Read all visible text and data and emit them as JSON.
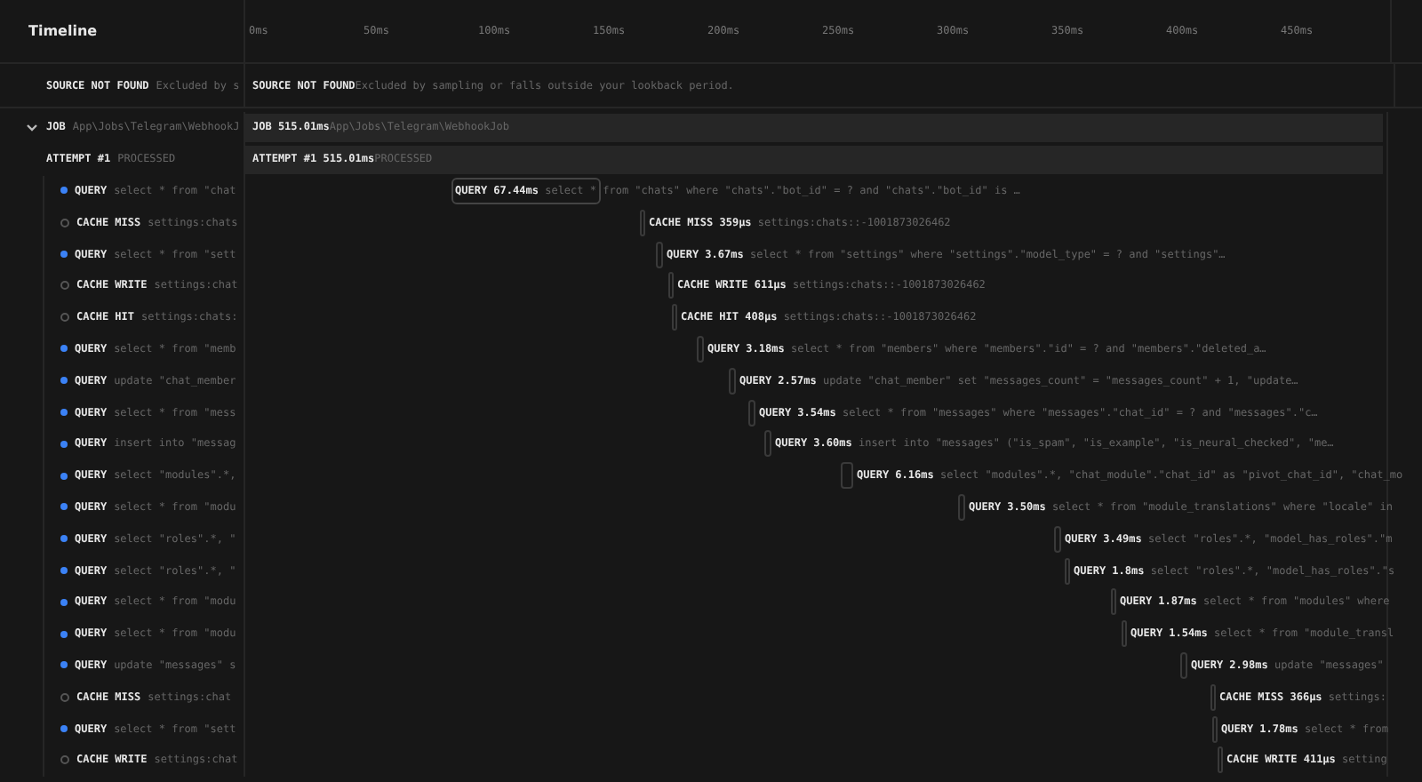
{
  "header": {
    "title": "Timeline",
    "ticks": [
      "0ms",
      "50ms",
      "100ms",
      "150ms",
      "200ms",
      "250ms",
      "300ms",
      "350ms",
      "400ms",
      "450ms"
    ]
  },
  "source": {
    "left_label": "SOURCE NOT FOUND",
    "left_detail": "Excluded by s",
    "label": "SOURCE NOT FOUND",
    "detail": "Excluded by sampling or falls outside your lookback period."
  },
  "job": {
    "expanded": true,
    "left_label": "JOB",
    "left_detail": "App\\Jobs\\Telegram\\WebhookJ",
    "label": "JOB",
    "duration": "515.01ms",
    "detail": "App\\Jobs\\Telegram\\WebhookJob"
  },
  "attempt": {
    "left_label": "ATTEMPT #1",
    "left_status": "PROCESSED",
    "label": "ATTEMPT #1",
    "duration": "515.01ms",
    "status": "PROCESSED"
  },
  "spans": [
    {
      "kind": "query",
      "left_label": "QUERY",
      "left_detail": "select * from \"chat",
      "label": "QUERY",
      "duration": "67.44ms",
      "detail": "select * from \"chats\" where \"chats\".\"bot_id\" = ? and \"chats\".\"bot_id\" is …"
    },
    {
      "kind": "cache",
      "left_label": "CACHE MISS",
      "left_detail": "settings:chats",
      "label": "CACHE MISS",
      "duration": "359μs",
      "detail": "settings:chats::-1001873026462"
    },
    {
      "kind": "query",
      "left_label": "QUERY",
      "left_detail": "select * from \"sett",
      "label": "QUERY",
      "duration": "3.67ms",
      "detail": "select * from \"settings\" where \"settings\".\"model_type\" = ? and \"settings\"…"
    },
    {
      "kind": "cache",
      "left_label": "CACHE WRITE",
      "left_detail": "settings:chat",
      "label": "CACHE WRITE",
      "duration": "611μs",
      "detail": "settings:chats::-1001873026462"
    },
    {
      "kind": "cache",
      "left_label": "CACHE HIT",
      "left_detail": "settings:chats:",
      "label": "CACHE HIT",
      "duration": "408μs",
      "detail": "settings:chats::-1001873026462"
    },
    {
      "kind": "query",
      "left_label": "QUERY",
      "left_detail": "select * from \"memb",
      "label": "QUERY",
      "duration": "3.18ms",
      "detail": "select * from \"members\" where \"members\".\"id\" = ? and \"members\".\"deleted_a…"
    },
    {
      "kind": "query",
      "left_label": "QUERY",
      "left_detail": "update \"chat_member",
      "label": "QUERY",
      "duration": "2.57ms",
      "detail": "update \"chat_member\" set \"messages_count\" = \"messages_count\" + 1, \"update…"
    },
    {
      "kind": "query",
      "left_label": "QUERY",
      "left_detail": "select * from \"mess",
      "label": "QUERY",
      "duration": "3.54ms",
      "detail": "select * from \"messages\" where \"messages\".\"chat_id\" = ? and \"messages\".\"c…"
    },
    {
      "kind": "query",
      "left_label": "QUERY",
      "left_detail": "insert into \"messag",
      "label": "QUERY",
      "duration": "3.60ms",
      "detail": "insert into \"messages\" (\"is_spam\", \"is_example\", \"is_neural_checked\", \"me…"
    },
    {
      "kind": "query",
      "left_label": "QUERY",
      "left_detail": "select \"modules\".*,",
      "label": "QUERY",
      "duration": "6.16ms",
      "detail": "select \"modules\".*, \"chat_module\".\"chat_id\" as \"pivot_chat_id\", \"chat_mo"
    },
    {
      "kind": "query",
      "left_label": "QUERY",
      "left_detail": "select * from \"modu",
      "label": "QUERY",
      "duration": "3.50ms",
      "detail": "select * from \"module_translations\" where \"locale\" in"
    },
    {
      "kind": "query",
      "left_label": "QUERY",
      "left_detail": "select \"roles\".*, \"",
      "label": "QUERY",
      "duration": "3.49ms",
      "detail": "select \"roles\".*, \"model_has_roles\".\"m"
    },
    {
      "kind": "query",
      "left_label": "QUERY",
      "left_detail": "select \"roles\".*, \"",
      "label": "QUERY",
      "duration": "1.8ms",
      "detail": "select \"roles\".*, \"model_has_roles\".\"s"
    },
    {
      "kind": "query",
      "left_label": "QUERY",
      "left_detail": "select * from \"modu",
      "label": "QUERY",
      "duration": "1.87ms",
      "detail": "select * from \"modules\" where"
    },
    {
      "kind": "query",
      "left_label": "QUERY",
      "left_detail": "select * from \"modu",
      "label": "QUERY",
      "duration": "1.54ms",
      "detail": "select * from \"module_transl"
    },
    {
      "kind": "query",
      "left_label": "QUERY",
      "left_detail": "update \"messages\" s",
      "label": "QUERY",
      "duration": "2.98ms",
      "detail": "update \"messages\""
    },
    {
      "kind": "cache",
      "left_label": "CACHE MISS",
      "left_detail": "settings:chat",
      "label": "CACHE MISS",
      "duration": "366μs",
      "detail": "settings:"
    },
    {
      "kind": "query",
      "left_label": "QUERY",
      "left_detail": "select * from \"sett",
      "label": "QUERY",
      "duration": "1.78ms",
      "detail": "select * from"
    },
    {
      "kind": "cache",
      "left_label": "CACHE WRITE",
      "left_detail": "settings:chat",
      "label": "CACHE WRITE",
      "duration": "411μs",
      "detail": "setting"
    }
  ]
}
